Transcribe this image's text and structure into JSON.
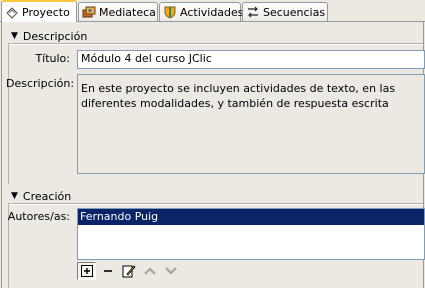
{
  "tabs": [
    {
      "label": "Proyecto",
      "icon": "project-icon",
      "active": true
    },
    {
      "label": "Mediateca",
      "icon": "media-icon",
      "active": false
    },
    {
      "label": "Actividades",
      "icon": "activities-icon",
      "active": false
    },
    {
      "label": "Secuencias",
      "icon": "sequences-icon",
      "active": false
    }
  ],
  "description_section": {
    "header": "Descripción",
    "title_label": "Título:",
    "title_value": "Módulo 4 del curso JClic",
    "description_label": "Descripción:",
    "description_value": "En este proyecto se incluyen actividades de texto, en las diferentes modalidades, y también de respuesta escrita"
  },
  "creation_section": {
    "header": "Creación",
    "authors_label": "Autores/as:",
    "authors": [
      "Fernando Puig"
    ]
  },
  "toolbar": {
    "add": "add-icon",
    "remove": "remove-icon",
    "edit": "edit-icon",
    "up": "arrow-up-icon",
    "down": "arrow-down-icon"
  },
  "colors": {
    "selection": "#0a246a",
    "tab_highlight": "#ffc83c",
    "background": "#ebe9e1"
  }
}
